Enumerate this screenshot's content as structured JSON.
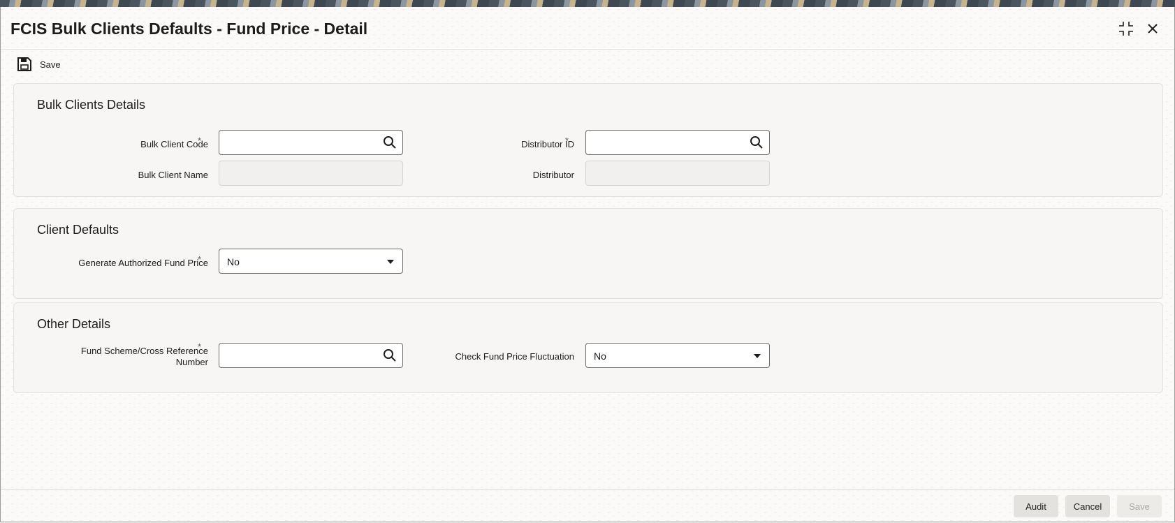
{
  "window": {
    "title": "FCIS Bulk Clients Defaults - Fund Price - Detail"
  },
  "toolbar": {
    "save_label": "Save",
    "save_icon": "floppy-disk-icon"
  },
  "sections": {
    "bulk_clients": {
      "heading": "Bulk Clients Details",
      "bulk_client_code": {
        "label": "Bulk Client Code",
        "required": "*",
        "value": ""
      },
      "bulk_client_name": {
        "label": "Bulk Client Name",
        "value": ""
      },
      "distributor_id": {
        "label": "Distributor ID",
        "required": "*",
        "value": ""
      },
      "distributor": {
        "label": "Distributor",
        "value": ""
      }
    },
    "client_defaults": {
      "heading": "Client Defaults",
      "generate_auth_fund_price": {
        "label": "Generate Authorized Fund Price",
        "required": "*",
        "value": "No"
      }
    },
    "other_details": {
      "heading": "Other Details",
      "fund_scheme": {
        "label_line1": "Fund Scheme/Cross Reference",
        "label_line2": "Number",
        "required": "*",
        "value": ""
      },
      "check_fluctuation": {
        "label": "Check Fund Price Fluctuation",
        "value": "No"
      }
    }
  },
  "footer": {
    "audit_label": "Audit",
    "cancel_label": "Cancel",
    "save_label": "Save"
  }
}
